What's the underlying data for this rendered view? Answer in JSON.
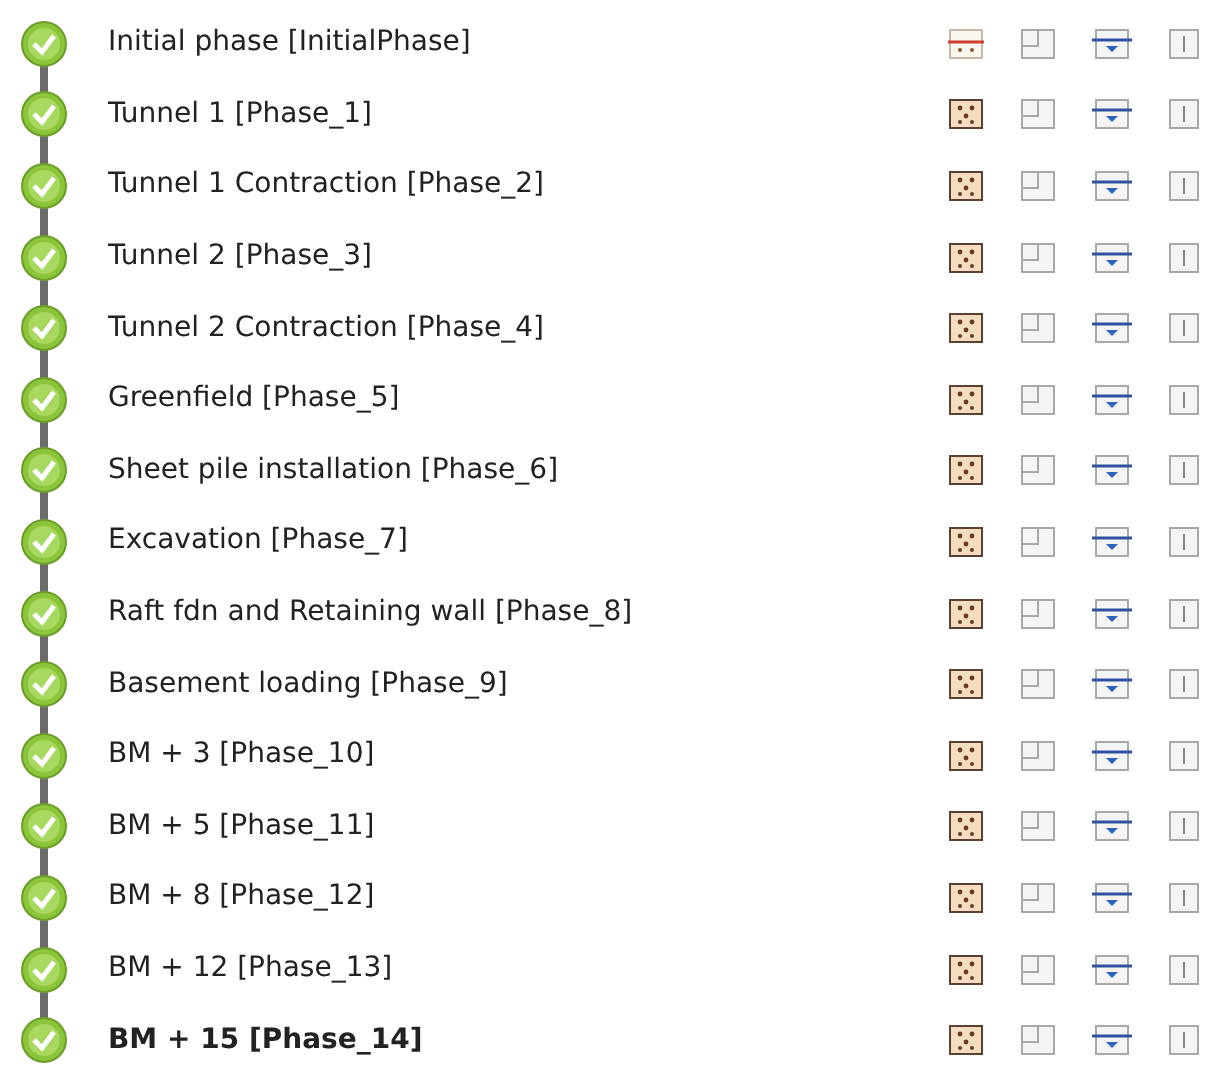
{
  "phases": [
    {
      "label": "Initial phase [InitialPhase]",
      "kind": "initial",
      "calculated": true,
      "selected": false
    },
    {
      "label": "Tunnel 1 [Phase_1]",
      "kind": "plastic",
      "calculated": true,
      "selected": false
    },
    {
      "label": "Tunnel 1 Contraction [Phase_2]",
      "kind": "plastic",
      "calculated": true,
      "selected": false
    },
    {
      "label": "Tunnel 2 [Phase_3]",
      "kind": "plastic",
      "calculated": true,
      "selected": false
    },
    {
      "label": "Tunnel 2 Contraction [Phase_4]",
      "kind": "plastic",
      "calculated": true,
      "selected": false
    },
    {
      "label": "Greenfield [Phase_5]",
      "kind": "plastic",
      "calculated": true,
      "selected": false
    },
    {
      "label": "Sheet pile installation [Phase_6]",
      "kind": "plastic",
      "calculated": true,
      "selected": false
    },
    {
      "label": "Excavation [Phase_7]",
      "kind": "plastic",
      "calculated": true,
      "selected": false
    },
    {
      "label": "Raft fdn and Retaining wall [Phase_8]",
      "kind": "plastic",
      "calculated": true,
      "selected": false
    },
    {
      "label": "Basement loading [Phase_9]",
      "kind": "plastic",
      "calculated": true,
      "selected": false
    },
    {
      "label": "BM + 3 [Phase_10]",
      "kind": "plastic",
      "calculated": true,
      "selected": false
    },
    {
      "label": "BM + 5 [Phase_11]",
      "kind": "plastic",
      "calculated": true,
      "selected": false
    },
    {
      "label": "BM + 8 [Phase_12]",
      "kind": "plastic",
      "calculated": true,
      "selected": false
    },
    {
      "label": "BM + 12 [Phase_13]",
      "kind": "plastic",
      "calculated": true,
      "selected": false
    },
    {
      "label": "BM + 15 [Phase_14]",
      "kind": "plastic",
      "calculated": true,
      "selected": true
    }
  ]
}
